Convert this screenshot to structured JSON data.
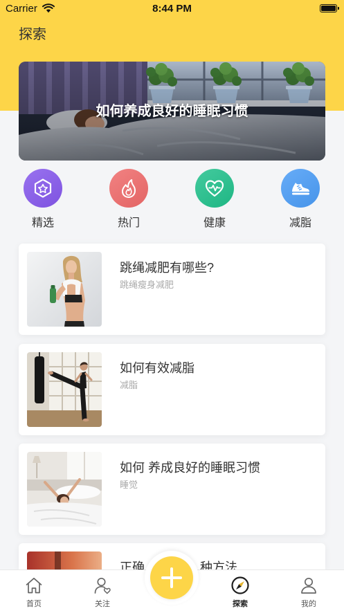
{
  "status_bar": {
    "carrier": "Carrier",
    "time": "8:44 PM",
    "wifi_icon": "wifi-icon",
    "battery_icon": "battery-icon"
  },
  "header": {
    "title": "探索"
  },
  "banner": {
    "title": "如何养成良好的睡眠习惯"
  },
  "categories": [
    {
      "label": "精选",
      "icon": "star-hexagon-icon",
      "color": "#8557EC"
    },
    {
      "label": "热门",
      "icon": "flame-icon",
      "color": "#EF6A6A"
    },
    {
      "label": "健康",
      "icon": "heart-pulse-icon",
      "color": "#20C08B"
    },
    {
      "label": "减脂",
      "icon": "sneaker-icon",
      "color": "#4A9CF6"
    }
  ],
  "articles": [
    {
      "title": "跳绳减肥有哪些?",
      "subtitle": "跳绳瘦身减肥"
    },
    {
      "title": "如何有效减脂",
      "subtitle": "减脂"
    },
    {
      "title": "如何 养成良好的睡眠习惯",
      "subtitle": "睡觉"
    },
    {
      "title_start": "正确",
      "title_end": "种方法"
    }
  ],
  "tab_bar": {
    "items": [
      {
        "label": "首页",
        "icon": "home-icon",
        "active": false
      },
      {
        "label": "关注",
        "icon": "follow-icon",
        "active": false
      },
      {
        "label": "探索",
        "icon": "compass-icon",
        "active": true
      },
      {
        "label": "我的",
        "icon": "profile-icon",
        "active": false
      }
    ],
    "fab_icon": "plus-icon"
  },
  "colors": {
    "accent": "#FDD548",
    "background": "#F4F5F7",
    "active_tab": "#222222"
  }
}
